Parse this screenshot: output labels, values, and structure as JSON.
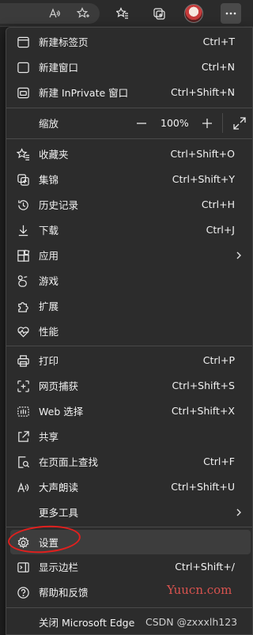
{
  "toolbar": {
    "icons": [
      "read-aloud-icon",
      "favorite-star-icon",
      "favorites-icon",
      "collections-icon",
      "profile-avatar",
      "more-icon"
    ]
  },
  "menu": {
    "new_tab": {
      "label": "新建标签页",
      "shortcut": "Ctrl+T"
    },
    "new_window": {
      "label": "新建窗口",
      "shortcut": "Ctrl+N"
    },
    "new_inprivate": {
      "label": "新建 InPrivate 窗口",
      "shortcut": "Ctrl+Shift+N"
    },
    "zoom": {
      "label": "缩放",
      "value": "100%"
    },
    "favorites": {
      "label": "收藏夹",
      "shortcut": "Ctrl+Shift+O"
    },
    "collections": {
      "label": "集锦",
      "shortcut": "Ctrl+Shift+Y"
    },
    "history": {
      "label": "历史记录",
      "shortcut": "Ctrl+H"
    },
    "downloads": {
      "label": "下载",
      "shortcut": "Ctrl+J"
    },
    "apps": {
      "label": "应用"
    },
    "games": {
      "label": "游戏"
    },
    "extensions": {
      "label": "扩展"
    },
    "performance": {
      "label": "性能"
    },
    "print": {
      "label": "打印",
      "shortcut": "Ctrl+P"
    },
    "web_capture": {
      "label": "网页捕获",
      "shortcut": "Ctrl+Shift+S"
    },
    "web_select": {
      "label": "Web 选择",
      "shortcut": "Ctrl+Shift+X"
    },
    "share": {
      "label": "共享"
    },
    "find": {
      "label": "在页面上查找",
      "shortcut": "Ctrl+F"
    },
    "read_aloud": {
      "label": "大声朗读",
      "shortcut": "Ctrl+Shift+U"
    },
    "more_tools": {
      "label": "更多工具"
    },
    "settings": {
      "label": "设置"
    },
    "sidebar": {
      "label": "显示边栏",
      "shortcut": "Ctrl+Shift+/"
    },
    "help": {
      "label": "帮助和反馈"
    },
    "close": {
      "label": "关闭 Microsoft Edge"
    }
  },
  "watermarks": {
    "yuucn": "Yuucn.com",
    "csdn": "CSDN @zxxxlh123"
  },
  "colors": {
    "menu_bg": "#2c2c2c",
    "highlight": "#3d3d3d",
    "annotation": "#e0201e"
  }
}
